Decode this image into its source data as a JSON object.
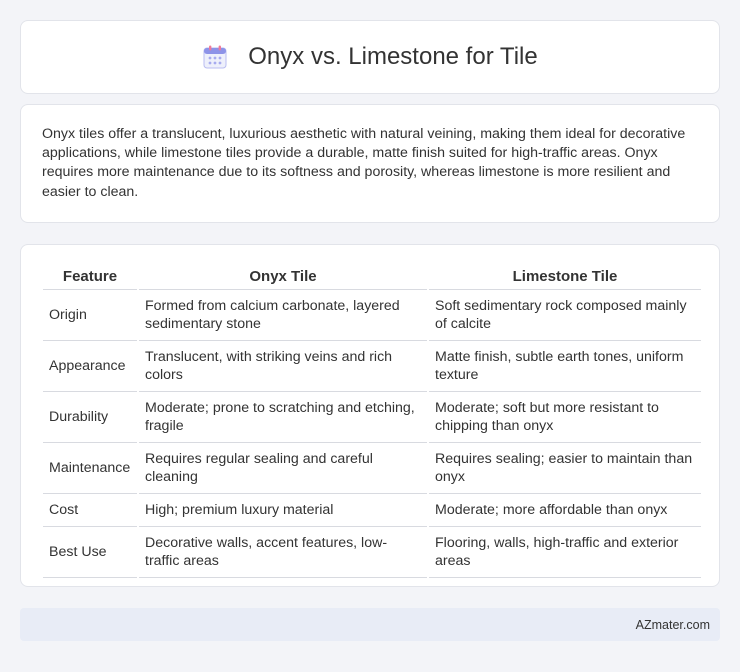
{
  "header": {
    "title": "Onyx vs. Limestone for Tile",
    "icon": "calendar-icon"
  },
  "intro": {
    "text": "Onyx tiles offer a translucent, luxurious aesthetic with natural veining, making them ideal for decorative applications, while limestone tiles provide a durable, matte finish suited for high-traffic areas. Onyx requires more maintenance due to its softness and porosity, whereas limestone is more resilient and easier to clean."
  },
  "table": {
    "headers": [
      "Feature",
      "Onyx Tile",
      "Limestone Tile"
    ],
    "rows": [
      [
        "Origin",
        "Formed from calcium carbonate, layered sedimentary stone",
        "Soft sedimentary rock composed mainly of calcite"
      ],
      [
        "Appearance",
        "Translucent, with striking veins and rich colors",
        "Matte finish, subtle earth tones, uniform texture"
      ],
      [
        "Durability",
        "Moderate; prone to scratching and etching, fragile",
        "Moderate; soft but more resistant to chipping than onyx"
      ],
      [
        "Maintenance",
        "Requires regular sealing and careful cleaning",
        "Requires sealing; easier to maintain than onyx"
      ],
      [
        "Cost",
        "High; premium luxury material",
        "Moderate; more affordable than onyx"
      ],
      [
        "Best Use",
        "Decorative walls, accent features, low-traffic areas",
        "Flooring, walls, high-traffic and exterior areas"
      ]
    ]
  },
  "footer": {
    "site": "AZmater.com"
  }
}
